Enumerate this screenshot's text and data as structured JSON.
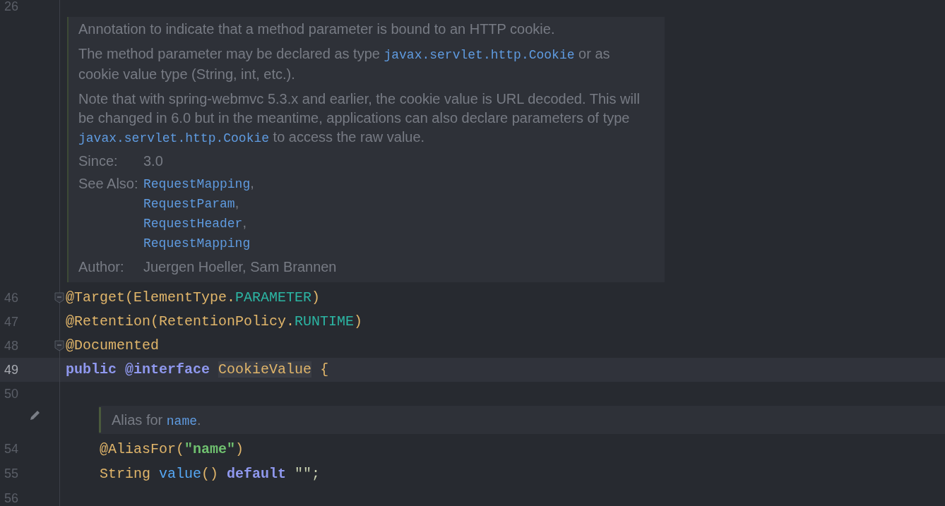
{
  "editor": {
    "top_line": {
      "number": "26"
    },
    "doc_popup": {
      "paragraphs": [
        [
          {
            "kind": "text",
            "text": "Annotation to indicate that a method parameter is bound to an HTTP cookie."
          }
        ],
        [
          {
            "kind": "text",
            "text": "The method parameter may be declared as type "
          },
          {
            "kind": "code",
            "text": "javax.servlet.http.Cookie"
          },
          {
            "kind": "text",
            "text": " or as cookie value type (String, int, etc.)."
          }
        ],
        [
          {
            "kind": "text",
            "text": "Note that with spring-webmvc 5.3.x and earlier, the cookie value is URL decoded. This will be changed in 6.0 but in the meantime, applications can also declare parameters of type "
          },
          {
            "kind": "code",
            "text": "javax.servlet.http.Cookie"
          },
          {
            "kind": "text",
            "text": " to access the raw value."
          }
        ]
      ],
      "since": {
        "label": "Since:",
        "value": "3.0"
      },
      "see_also": {
        "label": "See Also:",
        "items": [
          {
            "name": "RequestMapping",
            "separator": ","
          },
          {
            "name": "RequestParam",
            "separator": ","
          },
          {
            "name": "RequestHeader",
            "separator": ","
          },
          {
            "name": "RequestMapping"
          }
        ]
      },
      "author": {
        "label": "Author:",
        "value": "Juergen Hoeller, Sam Brannen"
      }
    },
    "lines": [
      {
        "number": "46",
        "current": false,
        "fold": true,
        "tokens": [
          {
            "kind": "annotation",
            "text": "@Target(ElementType."
          },
          {
            "kind": "constant",
            "text": "PARAMETER"
          },
          {
            "kind": "annotation",
            "text": ")"
          }
        ]
      },
      {
        "number": "47",
        "current": false,
        "fold": false,
        "tokens": [
          {
            "kind": "annotation",
            "text": "@Retention(RetentionPolicy."
          },
          {
            "kind": "constant",
            "text": "RUNTIME"
          },
          {
            "kind": "annotation",
            "text": ")"
          }
        ]
      },
      {
        "number": "48",
        "current": false,
        "fold": true,
        "tokens": [
          {
            "kind": "annotation",
            "text": "@Documented"
          }
        ]
      },
      {
        "number": "49",
        "current": true,
        "fold": false,
        "tokens": [
          {
            "kind": "keyword",
            "text": "public"
          },
          {
            "kind": "keyword",
            "text": "@interface"
          },
          {
            "kind": "declaration",
            "text": "CookieValue"
          },
          {
            "kind": "annotation",
            "text": "{"
          }
        ]
      },
      {
        "number": "50",
        "current": false,
        "fold": false
      }
    ],
    "inline_doc": [
      {
        "kind": "text",
        "text": "Alias for "
      },
      {
        "kind": "code",
        "text": "name"
      },
      {
        "kind": "text",
        "text": "."
      }
    ],
    "lines_after": [
      {
        "number": "54",
        "current": false,
        "fold": false,
        "tokens": [
          {
            "kind": "annotation",
            "text": "@AliasFor("
          },
          {
            "kind": "string",
            "text": "\"name\""
          },
          {
            "kind": "annotation",
            "text": ")"
          }
        ]
      },
      {
        "number": "55",
        "current": false,
        "fold": false,
        "tokens": [
          {
            "kind": "annotation",
            "text": "String"
          },
          {
            "kind": "method",
            "text": "value"
          },
          {
            "kind": "annotation",
            "text": "()"
          },
          {
            "kind": "keyword",
            "text": "default"
          },
          {
            "kind": "string_plain",
            "text": "\"\";"
          }
        ]
      },
      {
        "number": "56",
        "current": false,
        "fold": false
      }
    ]
  }
}
